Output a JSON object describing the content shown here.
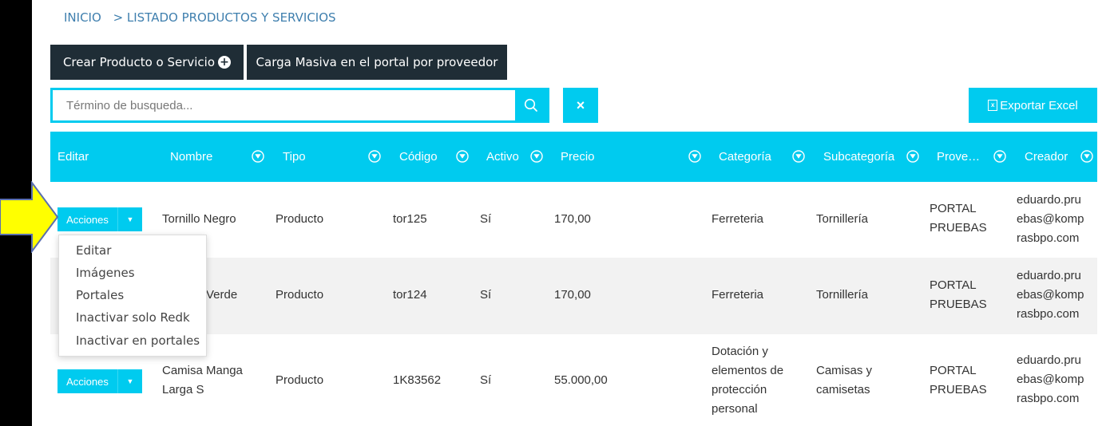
{
  "breadcrumb": {
    "home": "INICIO",
    "current": "> LISTADO PRODUCTOS Y SERVICIOS"
  },
  "toolbar": {
    "create_label": "Crear Producto o Servicio",
    "bulk_label": "Carga Masiva en el portal por proveedor",
    "export_label": "Exportar Excel",
    "clear_label": "×"
  },
  "search": {
    "placeholder": "Término de busqueda...",
    "value": ""
  },
  "table": {
    "headers": [
      "Editar",
      "Nombre",
      "Tipo",
      "Código",
      "Activo",
      "Precio",
      "Categoría",
      "Subcategoría",
      "Prove…",
      "Creador"
    ],
    "actions_label": "Acciones",
    "rows": [
      {
        "nombre": [
          "Tornillo Negro"
        ],
        "tipo": "Producto",
        "codigo": "tor125",
        "activo": "Sí",
        "precio": "170,00",
        "categoria": [
          "Ferreteria"
        ],
        "subcategoria": [
          "Tornillería"
        ],
        "proveedor": [
          "PORTAL",
          "PRUEBAS"
        ],
        "creador": [
          "eduardo.pru",
          "ebas@komp",
          "rasbpo.com"
        ]
      },
      {
        "nombre": [
          "Verde"
        ],
        "tipo": "Producto",
        "codigo": "tor124",
        "activo": "Sí",
        "precio": "170,00",
        "categoria": [
          "Ferreteria"
        ],
        "subcategoria": [
          "Tornillería"
        ],
        "proveedor": [
          "PORTAL",
          "PRUEBAS"
        ],
        "creador": [
          "eduardo.pru",
          "ebas@komp",
          "rasbpo.com"
        ]
      },
      {
        "nombre": [
          "Camisa Manga",
          "Larga S"
        ],
        "tipo": "Producto",
        "codigo": "1K83562",
        "activo": "Sí",
        "precio": "55.000,00",
        "categoria": [
          "Dotación y",
          "elementos de",
          "protección",
          "personal"
        ],
        "subcategoria": [
          "Camisas y",
          "camisetas"
        ],
        "proveedor": [
          "PORTAL",
          "PRUEBAS"
        ],
        "creador": [
          "eduardo.pru",
          "ebas@komp",
          "rasbpo.com"
        ]
      }
    ]
  },
  "dropdown": {
    "items": [
      "Editar",
      "Imágenes",
      "Portales",
      "Inactivar solo Redk",
      "Inactivar en portales"
    ]
  },
  "colors": {
    "accent": "#00cbef",
    "dark_button": "#1f2d36",
    "breadcrumb": "#3f7fae",
    "arrow": "#ffff00"
  },
  "icons": {
    "search": "search-icon",
    "filter": "filter-icon",
    "plus": "plus-circle-icon",
    "excel": "excel-file-icon",
    "caret": "caret-down-icon",
    "pointer": "arrow-pointer-icon"
  }
}
